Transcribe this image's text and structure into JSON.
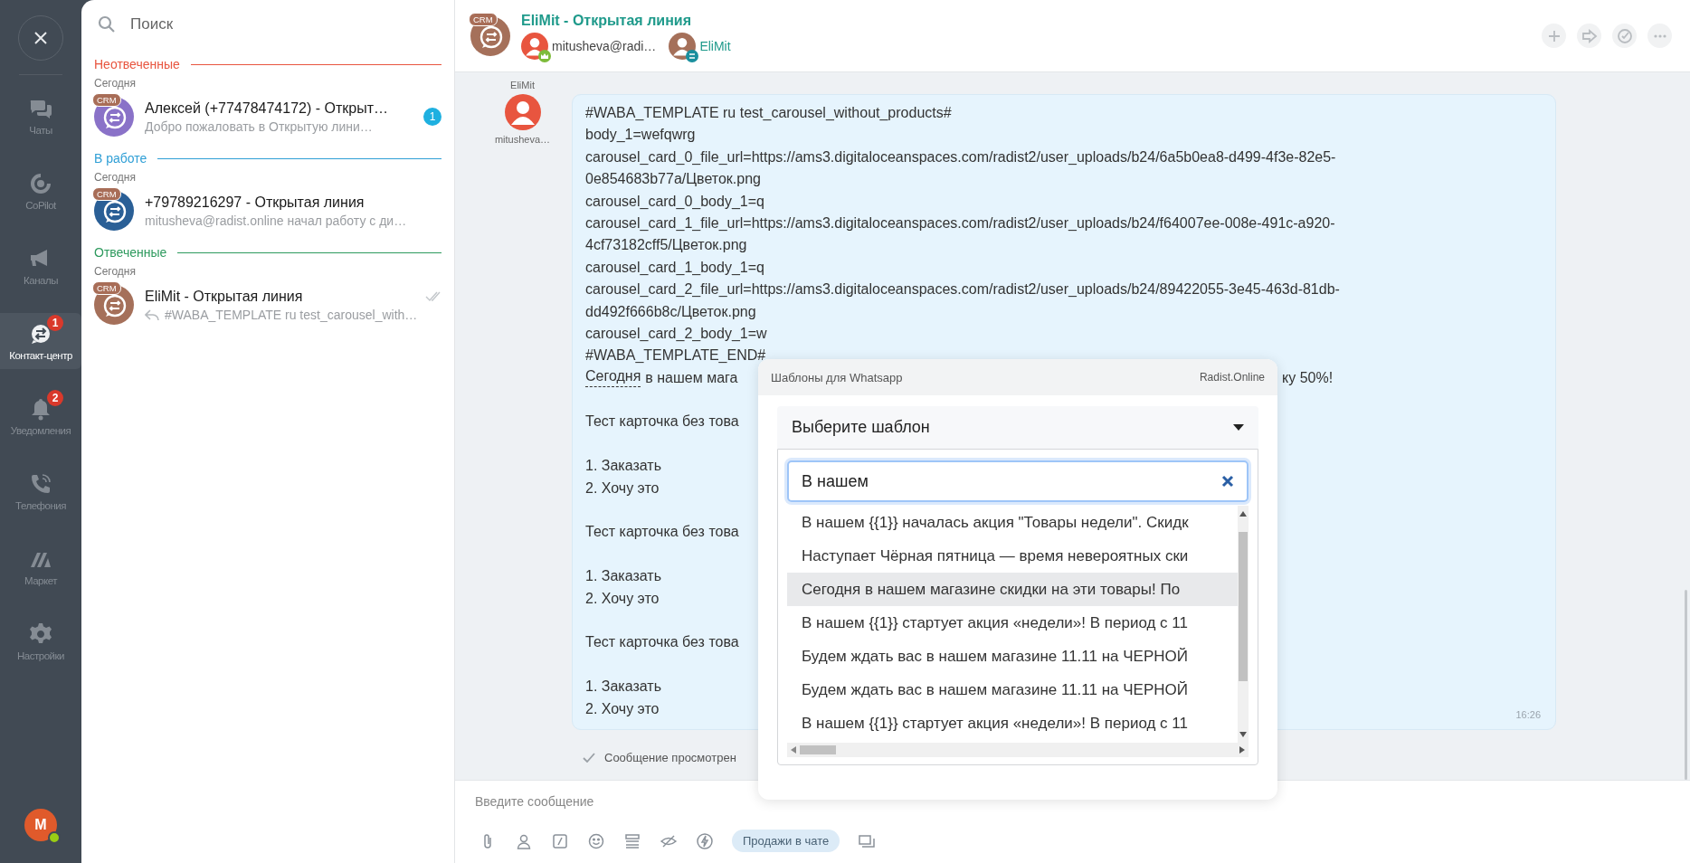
{
  "nav": {
    "items": [
      {
        "label": "Чаты",
        "selected": false
      },
      {
        "label": "CoPilot",
        "selected": false
      },
      {
        "label": "Каналы",
        "selected": false
      },
      {
        "label": "Контакт-центр",
        "selected": true,
        "badge": "1"
      },
      {
        "label": "Уведомления",
        "selected": false,
        "badge": "2"
      },
      {
        "label": "Телефония",
        "selected": false
      },
      {
        "label": "Маркет",
        "selected": false
      },
      {
        "label": "Настройки",
        "selected": false
      }
    ],
    "user": {
      "initial": "M",
      "online": true
    }
  },
  "chat_list": {
    "search": {
      "placeholder": "Поиск"
    },
    "groups": [
      {
        "title": "Неотвеченные",
        "color": "#e8553f",
        "date": "Сегодня",
        "chats": [
          {
            "crm": "CRM",
            "color": "#8a72c8",
            "name": "Алексей (+77478474172) - Открыт…",
            "preview": "Добро пожаловать в Открытую лини…",
            "unread": "1",
            "read": false,
            "outgoing": false
          }
        ]
      },
      {
        "title": "В работе",
        "color": "#2f9fd6",
        "date": "Сегодня",
        "chats": [
          {
            "crm": "CRM",
            "color": "#2a5f96",
            "name": "+79789216297 - Открытая линия",
            "preview": "mitusheva@radist.online начал работу с ди…",
            "read": false,
            "outgoing": false
          }
        ]
      },
      {
        "title": "Отвеченные",
        "color": "#2e9a5e",
        "date": "Сегодня",
        "chats": [
          {
            "crm": "CRM",
            "color": "#a5705a",
            "name": "EliMit - Открытая линия",
            "preview": "#WABA_TEMPLATE ru test_carousel_with…",
            "read": true,
            "outgoing": true
          }
        ]
      }
    ]
  },
  "header": {
    "crm": "CRM",
    "title": "EliMit - Открытая линия",
    "participants": [
      {
        "name": "mitusheva@radi…"
      },
      {
        "name": "EliMit"
      }
    ]
  },
  "message": {
    "sender": "EliMit",
    "sender_sub": "mitusheva…",
    "time": "16:26",
    "lines": [
      {
        "kind": "text",
        "text": "#WABA_TEMPLATE ru test_carousel_without_products#"
      },
      {
        "kind": "text",
        "text": "body_1=wefqwrg"
      },
      {
        "kind": "text",
        "text": "carousel_card_0_file_url=https://ams3.digitaloceanspaces.com/radist2/user_uploads/b24/6a5b0ea8-d499-4f3e-82e5-"
      },
      {
        "kind": "text",
        "text": "0e854683b77a/Цветок.png"
      },
      {
        "kind": "text",
        "text": "carousel_card_0_body_1=q"
      },
      {
        "kind": "text",
        "text": "carousel_card_1_file_url=https://ams3.digitaloceanspaces.com/radist2/user_uploads/b24/f64007ee-008e-491c-a920-"
      },
      {
        "kind": "text",
        "text": "4cf73182cff5/Цветок.png"
      },
      {
        "kind": "text",
        "text": "carousel_card_1_body_1=q"
      },
      {
        "kind": "text",
        "text": "carousel_card_2_file_url=https://ams3.digitaloceanspaces.com/radist2/user_uploads/b24/89422055-3e45-463d-81db-"
      },
      {
        "kind": "text",
        "text": "dd492f666b8c/Цветок.png"
      },
      {
        "kind": "text",
        "text": "carousel_card_2_body_1=w"
      },
      {
        "kind": "text",
        "text": "#WABA_TEMPLATE_END#"
      },
      {
        "kind": "split",
        "lead": "Сегодня",
        "text": "в нашем мага",
        "tail": "ку 50%!"
      },
      {
        "kind": "blank"
      },
      {
        "kind": "text",
        "text": "Тест карточка без това"
      },
      {
        "kind": "blank"
      },
      {
        "kind": "text",
        "text": "1. Заказать"
      },
      {
        "kind": "text",
        "text": "2. Хочу это"
      },
      {
        "kind": "blank"
      },
      {
        "kind": "text",
        "text": "Тест карточка без това"
      },
      {
        "kind": "blank"
      },
      {
        "kind": "text",
        "text": "1. Заказать"
      },
      {
        "kind": "text",
        "text": "2. Хочу это"
      },
      {
        "kind": "blank"
      },
      {
        "kind": "text",
        "text": "Тест карточка без това"
      },
      {
        "kind": "blank"
      },
      {
        "kind": "text",
        "text": "1. Заказать"
      },
      {
        "kind": "text",
        "text": "2. Хочу это"
      }
    ]
  },
  "seen": "Сообщение просмотрен",
  "composer": {
    "placeholder": "Введите сообщение",
    "chip": "Продажи в чате"
  },
  "popup": {
    "title": "Шаблоны для Whatsapp",
    "brand": "Radist.Online",
    "select": {
      "placeholder": "Выберите шаблон",
      "expanded": true
    },
    "search": {
      "value": "В нашем"
    },
    "options": [
      {
        "text": "В нашем {{1}} началась акция \"Товары недели\". Скидк",
        "selected": false
      },
      {
        "text": "Наступает Чёрная пятница — время невероятных ски",
        "selected": false
      },
      {
        "text": "Сегодня в нашем магазине скидки на эти товары! По",
        "selected": true
      },
      {
        "text": "В нашем {{1}} стартует акция «недели»! В период с 11",
        "selected": false
      },
      {
        "text": "Будем ждать вас в нашем магазине 11.11 на ЧЕРНОЙ",
        "selected": false
      },
      {
        "text": "Будем ждать вас в нашем магазине 11.11 на ЧЕРНОЙ",
        "selected": false
      },
      {
        "text": "В нашем {{1}} стартует акция «недели»! В период с 11",
        "selected": false
      }
    ]
  }
}
